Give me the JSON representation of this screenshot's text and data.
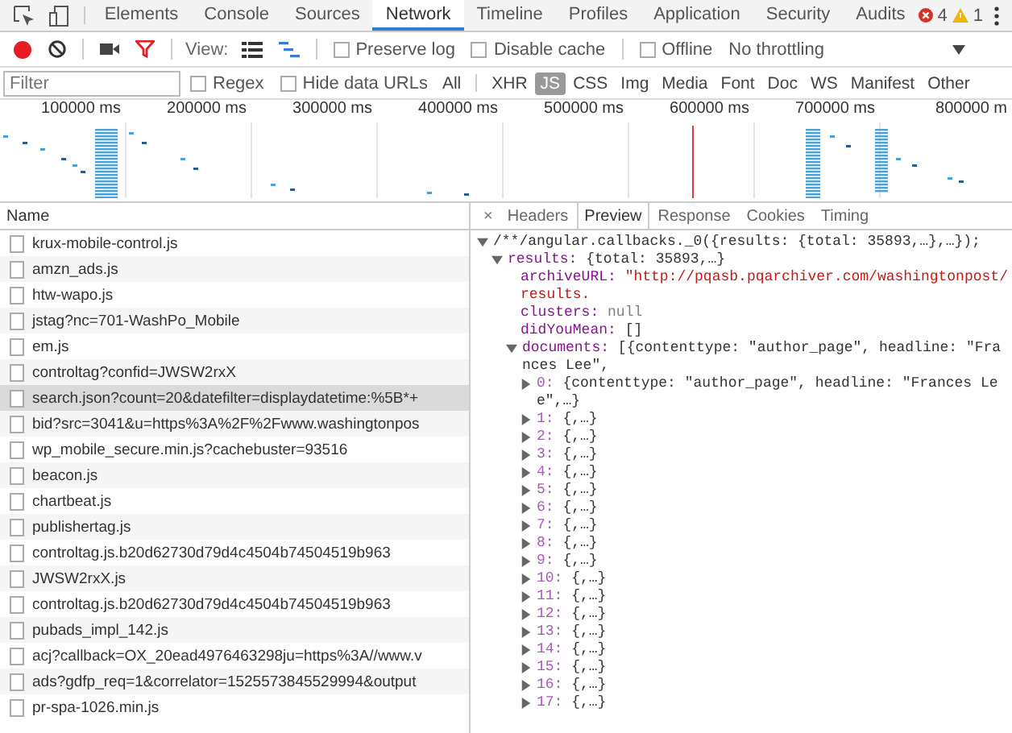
{
  "tabs": [
    {
      "label": "Elements",
      "selected": false
    },
    {
      "label": "Console",
      "selected": false
    },
    {
      "label": "Sources",
      "selected": false
    },
    {
      "label": "Network",
      "selected": true
    },
    {
      "label": "Timeline",
      "selected": false
    },
    {
      "label": "Profiles",
      "selected": false
    },
    {
      "label": "Application",
      "selected": false
    },
    {
      "label": "Security",
      "selected": false
    },
    {
      "label": "Audits",
      "selected": false
    }
  ],
  "counters": {
    "errors": "4",
    "warnings": "1"
  },
  "toolbar": {
    "recording": true,
    "filter_on": true,
    "view_label": "View:",
    "views": [
      {
        "kind": "list",
        "selected": false
      },
      {
        "kind": "waterfall",
        "selected": true
      }
    ],
    "options": [
      {
        "label": "Preserve log",
        "checked": false
      },
      {
        "label": "Disable cache",
        "checked": false
      },
      {
        "label": "Offline",
        "checked": false
      }
    ],
    "throttling": "No throttling"
  },
  "filter_bar": {
    "placeholder": "Filter",
    "options": [
      {
        "label": "Regex",
        "checked": false
      },
      {
        "label": "Hide data URLs",
        "checked": false
      }
    ],
    "types": [
      {
        "label": "All",
        "selected": false
      },
      {
        "label": "XHR",
        "selected": false
      },
      {
        "label": "JS",
        "selected": true
      },
      {
        "label": "CSS",
        "selected": false
      },
      {
        "label": "Img",
        "selected": false
      },
      {
        "label": "Media",
        "selected": false
      },
      {
        "label": "Font",
        "selected": false
      },
      {
        "label": "Doc",
        "selected": false
      },
      {
        "label": "WS",
        "selected": false
      },
      {
        "label": "Manifest",
        "selected": false
      },
      {
        "label": "Other",
        "selected": false
      }
    ]
  },
  "timeline": {
    "ticks": [
      "100000 ms",
      "200000 ms",
      "300000 ms",
      "400000 ms",
      "500000 ms",
      "600000 ms",
      "700000 ms",
      "800000 m"
    ]
  },
  "requests": {
    "column": "Name",
    "rows": [
      {
        "name": "krux-mobile-control.js",
        "selected": false
      },
      {
        "name": "amzn_ads.js",
        "selected": false
      },
      {
        "name": "htw-wapo.js",
        "selected": false
      },
      {
        "name": "jstag?nc=701-WashPo_Mobile",
        "selected": false
      },
      {
        "name": "em.js",
        "selected": false
      },
      {
        "name": "controltag?confid=JWSW2rxX",
        "selected": false
      },
      {
        "name": "search.json?count=20&datefilter=displaydatetime:%5B*+",
        "selected": true
      },
      {
        "name": "bid?src=3041&u=https%3A%2F%2Fwww.washingtonpos",
        "selected": false
      },
      {
        "name": "wp_mobile_secure.min.js?cachebuster=93516",
        "selected": false
      },
      {
        "name": "beacon.js",
        "selected": false
      },
      {
        "name": "chartbeat.js",
        "selected": false
      },
      {
        "name": "publishertag.js",
        "selected": false
      },
      {
        "name": "controltag.js.b20d62730d79d4c4504b74504519b963",
        "selected": false
      },
      {
        "name": "JWSW2rxX.js",
        "selected": false
      },
      {
        "name": "controltag.js.b20d62730d79d4c4504b74504519b963",
        "selected": false
      },
      {
        "name": "pubads_impl_142.js",
        "selected": false
      },
      {
        "name": "acj?callback=OX_20ead4976463298ju=https%3A//www.v",
        "selected": false
      },
      {
        "name": "ads?gdfp_req=1&correlator=1525573845529994&output",
        "selected": false
      },
      {
        "name": "pr-spa-1026.min.js",
        "selected": false
      }
    ]
  },
  "detail": {
    "close": "×",
    "tabs": [
      {
        "label": "Headers",
        "selected": false
      },
      {
        "label": "Preview",
        "selected": true
      },
      {
        "label": "Response",
        "selected": false
      },
      {
        "label": "Cookies",
        "selected": false
      },
      {
        "label": "Timing",
        "selected": false
      }
    ],
    "tree": [
      {
        "kind": "call",
        "text": "/**/angular.callbacks._0({results: {total: 35893,…},…});",
        "expanded": true,
        "children": [
          {
            "kind": "object",
            "key": "results:",
            "value": "{total: 35893,…}",
            "expanded": true,
            "children": [
              {
                "kind": "string",
                "key": "archiveURL:",
                "value": "\"http://pqasb.pqarchiver.com/washingtonpost/results."
              },
              {
                "kind": "null",
                "key": "clusters:",
                "value": "null"
              },
              {
                "kind": "plain",
                "key": "didYouMean:",
                "value": "[]"
              },
              {
                "kind": "object",
                "key": "documents:",
                "value": "[{contenttype: \"author_page\", headline: \"Frances Lee\",",
                "expanded": true,
                "children": [
                  {
                    "kind": "item",
                    "key": "0:",
                    "value": "{contenttype: \"author_page\", headline: \"Frances Lee\",…}",
                    "expanded": false
                  },
                  {
                    "kind": "item",
                    "key": "1:",
                    "value": "{,…}",
                    "expanded": false
                  },
                  {
                    "kind": "item",
                    "key": "2:",
                    "value": "{,…}",
                    "expanded": false
                  },
                  {
                    "kind": "item",
                    "key": "3:",
                    "value": "{,…}",
                    "expanded": false
                  },
                  {
                    "kind": "item",
                    "key": "4:",
                    "value": "{,…}",
                    "expanded": false
                  },
                  {
                    "kind": "item",
                    "key": "5:",
                    "value": "{,…}",
                    "expanded": false
                  },
                  {
                    "kind": "item",
                    "key": "6:",
                    "value": "{,…}",
                    "expanded": false
                  },
                  {
                    "kind": "item",
                    "key": "7:",
                    "value": "{,…}",
                    "expanded": false
                  },
                  {
                    "kind": "item",
                    "key": "8:",
                    "value": "{,…}",
                    "expanded": false
                  },
                  {
                    "kind": "item",
                    "key": "9:",
                    "value": "{,…}",
                    "expanded": false
                  },
                  {
                    "kind": "item",
                    "key": "10:",
                    "value": "{,…}",
                    "expanded": false
                  },
                  {
                    "kind": "item",
                    "key": "11:",
                    "value": "{,…}",
                    "expanded": false
                  },
                  {
                    "kind": "item",
                    "key": "12:",
                    "value": "{,…}",
                    "expanded": false
                  },
                  {
                    "kind": "item",
                    "key": "13:",
                    "value": "{,…}",
                    "expanded": false
                  },
                  {
                    "kind": "item",
                    "key": "14:",
                    "value": "{,…}",
                    "expanded": false
                  },
                  {
                    "kind": "item",
                    "key": "15:",
                    "value": "{,…}",
                    "expanded": false
                  },
                  {
                    "kind": "item",
                    "key": "16:",
                    "value": "{,…}",
                    "expanded": false
                  },
                  {
                    "kind": "item",
                    "key": "17:",
                    "value": "{,…}",
                    "expanded": false
                  }
                ]
              }
            ]
          }
        ]
      }
    ]
  }
}
